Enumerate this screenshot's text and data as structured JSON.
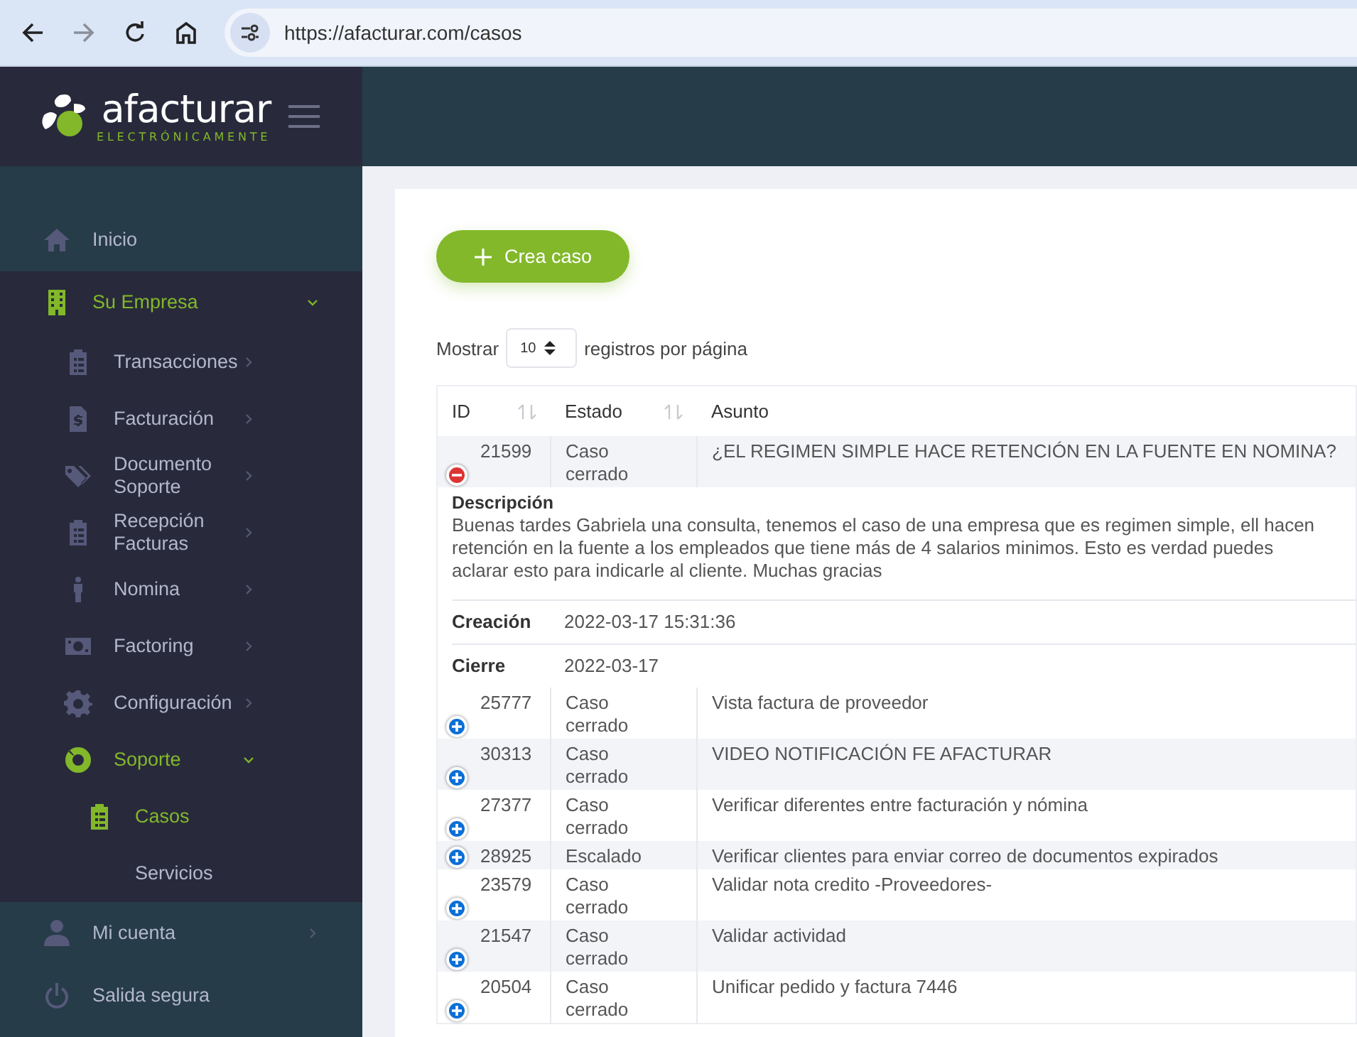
{
  "browser": {
    "url": "https://afacturar.com/casos",
    "can_go_forward": false
  },
  "sidebar": {
    "logo": {
      "name": "afacturar",
      "tagline": "ELECTRÓNICAMENTE"
    },
    "items": [
      {
        "label": "Inicio",
        "selected": false
      },
      {
        "label": "Su Empresa",
        "selected": true,
        "expanded": true,
        "children": [
          {
            "label": "Transacciones",
            "selected": false,
            "expanded": false
          },
          {
            "label": "Facturación",
            "selected": false,
            "expanded": false
          },
          {
            "label": "Documento Soporte",
            "selected": false,
            "expanded": false
          },
          {
            "label": "Recepción Facturas",
            "selected": false,
            "expanded": false
          },
          {
            "label": "Nomina",
            "selected": false,
            "expanded": false
          },
          {
            "label": "Factoring",
            "selected": false,
            "expanded": false
          },
          {
            "label": "Configuración",
            "selected": false,
            "expanded": false
          },
          {
            "label": "Soporte",
            "selected": true,
            "expanded": true,
            "children": [
              {
                "label": "Casos",
                "selected": true
              },
              {
                "label": "Servicios",
                "selected": false
              }
            ]
          }
        ]
      },
      {
        "label": "Mi cuenta",
        "selected": false,
        "expanded": false
      },
      {
        "label": "Salida segura",
        "selected": false
      }
    ]
  },
  "content": {
    "create_button": "Crea caso",
    "page_size": {
      "prefix": "Mostrar",
      "value": "10",
      "suffix": "registros por página"
    },
    "table": {
      "columns": [
        {
          "label": "ID",
          "sortable": true
        },
        {
          "label": "Estado",
          "sortable": true
        },
        {
          "label": "Asunto",
          "sortable": false
        }
      ],
      "rows": [
        {
          "id": "21599",
          "status": "Caso cerrado",
          "subject": "¿EL REGIMEN SIMPLE HACE RETENCIÓN EN LA FUENTE EN NOMINA?",
          "expanded": true,
          "details": {
            "description_label": "Descripción",
            "description": "Buenas tardes Gabriela una consulta, tenemos el caso de una empresa que es regimen simple, ell hacen retención en la fuente a los empleados que tiene más de 4 salarios minimos. Esto es verdad puedes aclarar esto para indicarle al cliente. Muchas gracias",
            "fields": [
              {
                "label": "Creación",
                "value": "2022-03-17 15:31:36"
              },
              {
                "label": "Cierre",
                "value": "2022-03-17"
              }
            ]
          }
        },
        {
          "id": "25777",
          "status": "Caso cerrado",
          "subject": "Vista factura de proveedor",
          "expanded": false
        },
        {
          "id": "30313",
          "status": "Caso cerrado",
          "subject": "VIDEO NOTIFICACIÓN FE AFACTURAR",
          "expanded": false
        },
        {
          "id": "27377",
          "status": "Caso cerrado",
          "subject": "Verificar diferentes entre facturación y nómina",
          "expanded": false
        },
        {
          "id": "28925",
          "status": "Escalado",
          "subject": "Verificar clientes para enviar correo de documentos expirados",
          "expanded": false
        },
        {
          "id": "23579",
          "status": "Caso cerrado",
          "subject": "Validar nota credito -Proveedores-",
          "expanded": false
        },
        {
          "id": "21547",
          "status": "Caso cerrado",
          "subject": "Validar actividad",
          "expanded": false
        },
        {
          "id": "20504",
          "status": "Caso cerrado",
          "subject": "Unificar pedido y factura 7446",
          "expanded": false
        }
      ]
    }
  }
}
